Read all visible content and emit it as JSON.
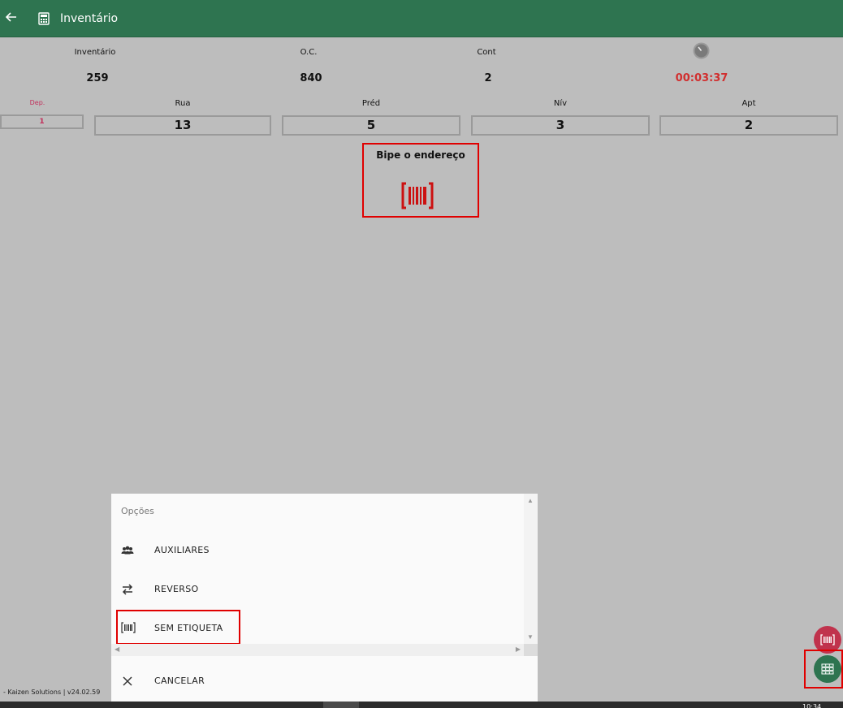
{
  "header": {
    "title": "Inventário",
    "back_icon": "arrow-left-icon",
    "app_icon": "calculator-icon"
  },
  "info": {
    "inventario": {
      "label": "Inventário",
      "value": "259"
    },
    "oc": {
      "label": "O.C.",
      "value": "840"
    },
    "cont": {
      "label": "Cont",
      "value": "2"
    },
    "timer": {
      "icon": "clock-icon",
      "value": "00:03:37",
      "color": "#d12e2e"
    }
  },
  "address": {
    "dep": {
      "label": "Dep.",
      "value": "1"
    },
    "rua": {
      "label": "Rua",
      "value": "13"
    },
    "pred": {
      "label": "Préd",
      "value": "5"
    },
    "niv": {
      "label": "Nív",
      "value": "3"
    },
    "apt": {
      "label": "Apt",
      "value": "2"
    }
  },
  "scan_prompt": {
    "text": "Bipe o endereço",
    "icon": "barcode-icon"
  },
  "options_sheet": {
    "title": "Opções",
    "items": [
      {
        "label": "AUXILIARES",
        "icon": "people-icon"
      },
      {
        "label": "REVERSO",
        "icon": "swap-icon"
      },
      {
        "label": "SEM ETIQUETA",
        "icon": "barcode-icon"
      }
    ],
    "cancel": {
      "label": "CANCELAR",
      "icon": "close-icon"
    }
  },
  "footer": {
    "text": "- Kaizen Solutions  |  v24.02.59",
    "clock": "10:34"
  },
  "colors": {
    "primary": "#2e7450",
    "accent_red": "#c0334d",
    "highlight": "#e00000"
  }
}
